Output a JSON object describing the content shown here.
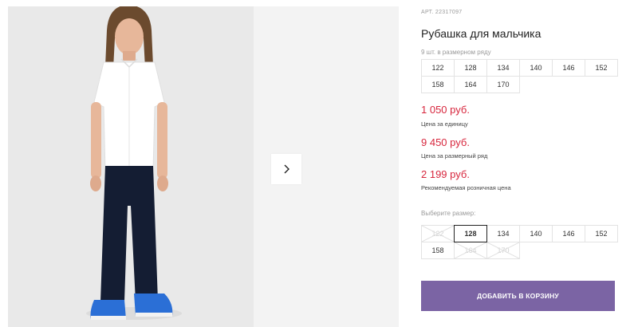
{
  "product": {
    "sku": "АРТ. 22317097",
    "title": "Рубашка для мальчика",
    "pack_note": "9 шт. в размерном ряду",
    "pack_sizes": [
      "122",
      "128",
      "134",
      "140",
      "146",
      "152",
      "158",
      "164",
      "170"
    ]
  },
  "prices": {
    "unit_value": "1 050 руб.",
    "unit_label": "Цена за единицу",
    "pack_value": "9 450 руб.",
    "pack_label": "Цена за размерный ряд",
    "retail_value": "2 199 руб.",
    "retail_label": "Рекомендуемая розничная цена",
    "accent_color": "#d7263d"
  },
  "size_picker": {
    "label": "Выберите размер:",
    "options": [
      {
        "label": "122",
        "state": "disabled"
      },
      {
        "label": "128",
        "state": "selected"
      },
      {
        "label": "134",
        "state": "available"
      },
      {
        "label": "140",
        "state": "available"
      },
      {
        "label": "146",
        "state": "available"
      },
      {
        "label": "152",
        "state": "available"
      },
      {
        "label": "158",
        "state": "available"
      },
      {
        "label": "164",
        "state": "disabled"
      },
      {
        "label": "170",
        "state": "disabled"
      }
    ]
  },
  "cart": {
    "button_label": "ДОБАВИТЬ В КОРЗИНУ",
    "button_color": "#7b64a4"
  },
  "gallery": {
    "next_icon": "chevron-right-icon"
  }
}
